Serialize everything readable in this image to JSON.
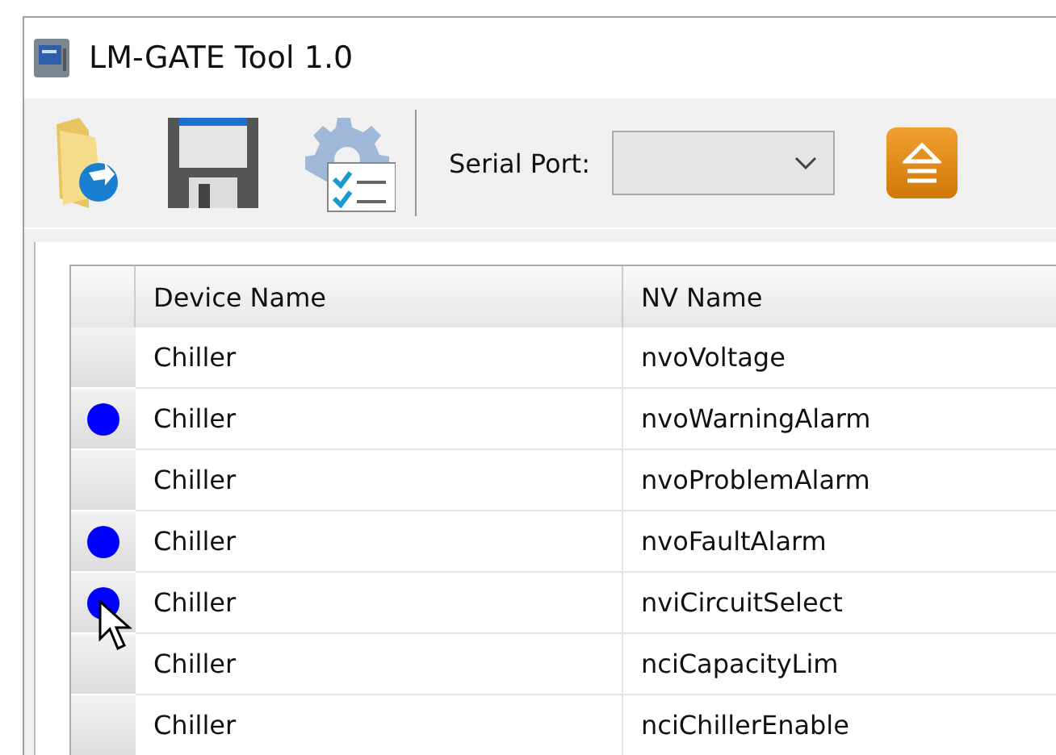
{
  "window": {
    "title": "LM-GATE Tool 1.0"
  },
  "toolbar": {
    "serial_port_label": "Serial Port:"
  },
  "table": {
    "columns": [
      "Device Name",
      "NV Name"
    ],
    "rows": [
      {
        "device": "Chiller",
        "nv": "nvoVoltage",
        "marked": false
      },
      {
        "device": "Chiller",
        "nv": "nvoWarningAlarm",
        "marked": true
      },
      {
        "device": "Chiller",
        "nv": "nvoProblemAlarm",
        "marked": false
      },
      {
        "device": "Chiller",
        "nv": "nvoFaultAlarm",
        "marked": true
      },
      {
        "device": "Chiller",
        "nv": "nviCircuitSelect",
        "marked": true
      },
      {
        "device": "Chiller",
        "nv": "nciCapacityLim",
        "marked": false
      },
      {
        "device": "Chiller",
        "nv": "nciChillerEnable",
        "marked": false
      }
    ]
  }
}
